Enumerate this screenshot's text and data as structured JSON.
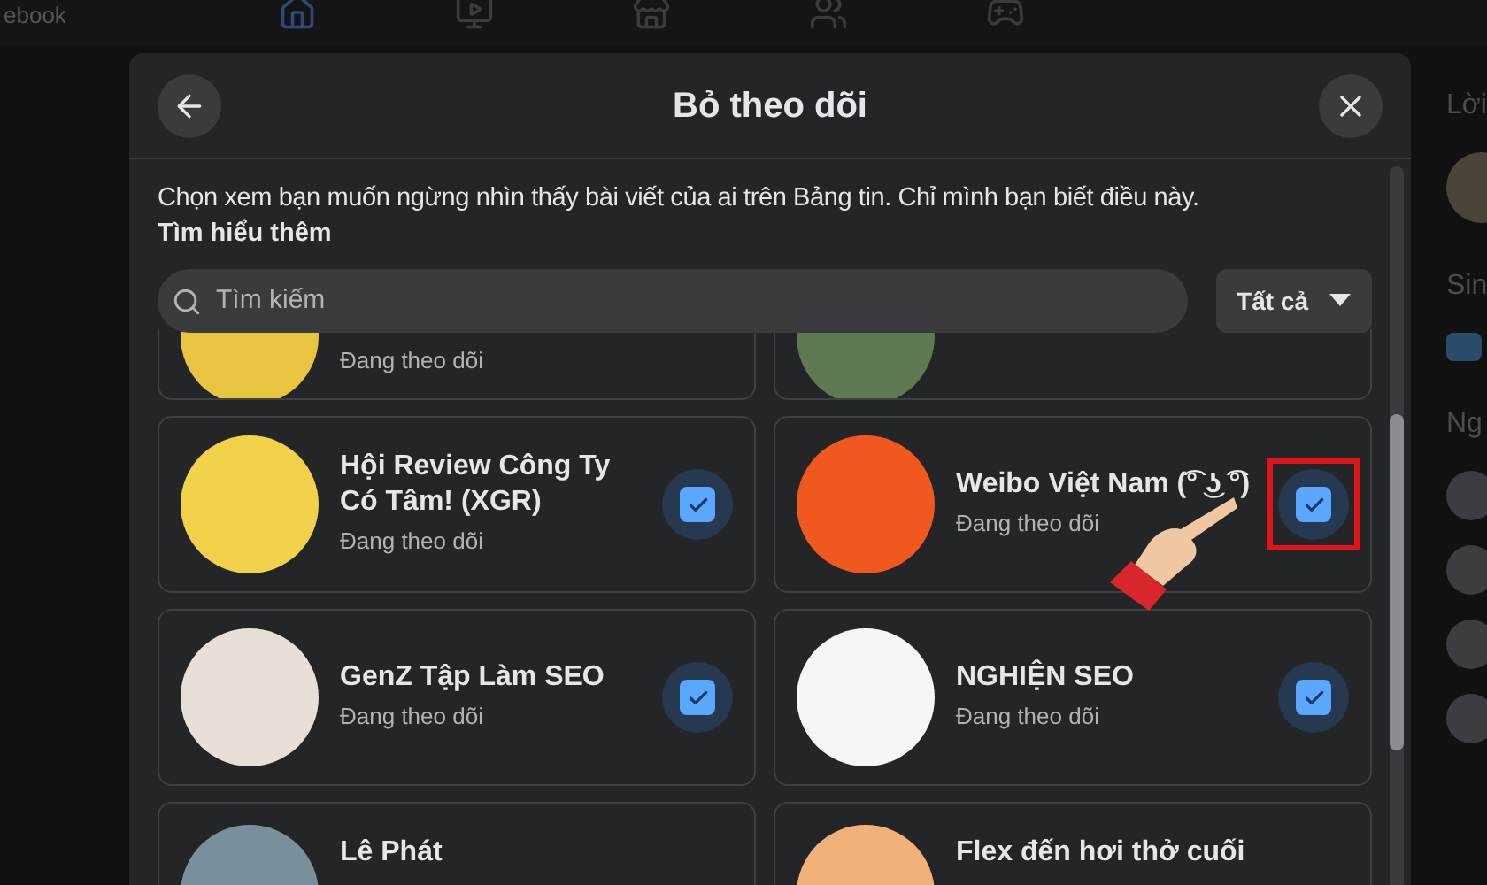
{
  "background": {
    "brand_fragment": "ebook",
    "sidebar_headings": [
      "Lời",
      "Sin",
      "Ng"
    ]
  },
  "dialog": {
    "title": "Bỏ theo dõi",
    "description": "Chọn xem bạn muốn ngừng nhìn thấy bài viết của ai trên Bảng tin. Chỉ mình bạn biết điều này.",
    "learn_more": "Tìm hiểu thêm",
    "search": {
      "placeholder": "Tìm kiếm"
    },
    "filter": "Tất cả"
  },
  "pages": [
    {
      "kind": "partial",
      "status": "Đang theo dõi"
    },
    {
      "kind": "partial"
    },
    {
      "kind": "full",
      "name": "Hội Review Công Ty Có Tâm! (XGR)",
      "status": "Đang theo dõi",
      "checked": true,
      "highlighted": false
    },
    {
      "kind": "full",
      "name": "Weibo Việt Nam (͡° ͜ʖ ͡°)",
      "status": "Đang theo dõi",
      "checked": true,
      "highlighted": true
    },
    {
      "kind": "full",
      "name": "GenZ Tập Làm SEO",
      "status": "Đang theo dõi",
      "checked": true,
      "highlighted": false
    },
    {
      "kind": "full",
      "name": "NGHIỆN SEO",
      "status": "Đang theo dõi",
      "checked": true,
      "highlighted": false
    },
    {
      "kind": "cut",
      "name": "Lê Phát"
    },
    {
      "kind": "cut",
      "name": "Flex đến hơi thở cuối"
    }
  ]
}
